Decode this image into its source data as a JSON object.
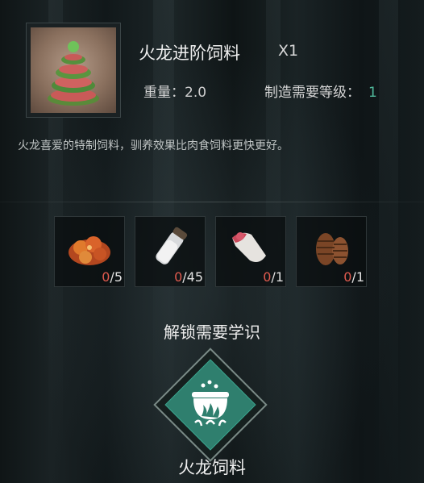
{
  "item": {
    "name": "火龙进阶饲料",
    "quantity": "X1",
    "weight_label": "重量：",
    "weight_value": "2.0",
    "level_label": "制造需要等级：",
    "level_value": "1",
    "description": "火龙喜爱的特制饲料，驯养效果比肉食饲料更快更好。",
    "icon": "layered-feed-cake-icon"
  },
  "ingredients": [
    {
      "icon": "cooked-meat-icon",
      "have": "0",
      "need": "/5"
    },
    {
      "icon": "salt-shaker-icon",
      "have": "0",
      "need": "/45"
    },
    {
      "icon": "raw-meat-bone-icon",
      "have": "0",
      "need": "/1"
    },
    {
      "icon": "pine-cone-icon",
      "have": "0",
      "need": "/1"
    }
  ],
  "unlock": {
    "label": "解锁需要学识",
    "skill_name": "火龙饲料",
    "skill_icon": "cooking-pot-icon"
  },
  "colors": {
    "have_count": "#e05a4e",
    "level_value": "#4fb89a",
    "diamond_fill": "#2f7f6e"
  }
}
